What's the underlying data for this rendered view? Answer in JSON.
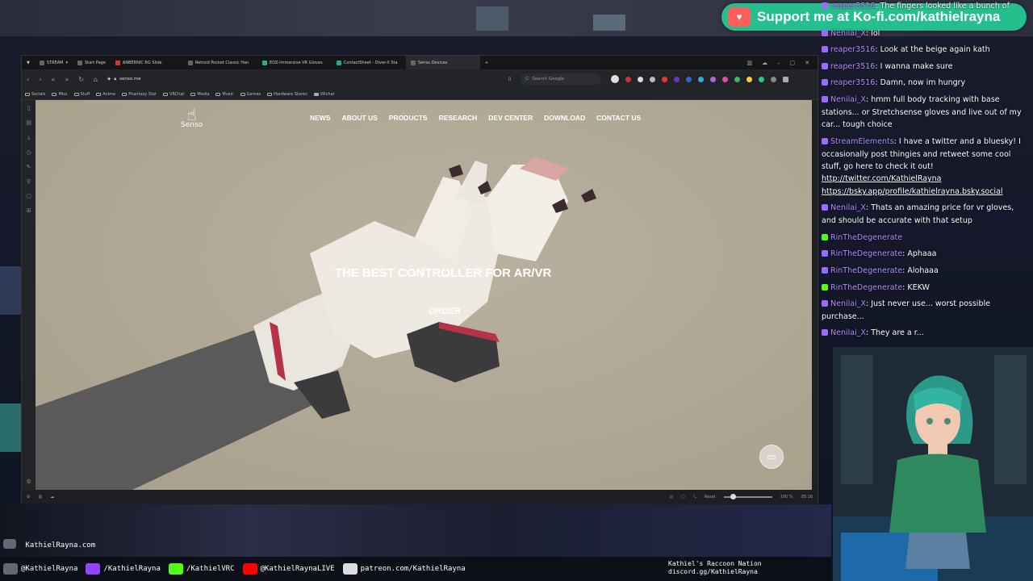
{
  "browser": {
    "tabs": [
      {
        "label": "STREAM",
        "active": false
      },
      {
        "label": "Start Page",
        "active": false
      },
      {
        "label": "ANBERNIC RG Slide",
        "active": false
      },
      {
        "label": "Retroid Pocket Classic Han",
        "active": false
      },
      {
        "label": "EOZ-Immersive VR Gloves",
        "active": false
      },
      {
        "label": "ContactSheet - Diver-X Sta",
        "active": false
      },
      {
        "label": "Senso Devices",
        "active": true
      }
    ],
    "new_tab": "+",
    "url": "senso.me",
    "search_placeholder": "Search Google",
    "bookmarks": [
      "Socials",
      "Misc",
      "Stuff",
      "Anime",
      "Phantasy Star",
      "VRChat",
      "Media",
      "Music",
      "Games",
      "Hardware Stores",
      "VRchat"
    ],
    "status": {
      "reset": "Reset",
      "zoom": "100 %",
      "clock": "05:16"
    }
  },
  "site": {
    "logo_text": "Senso",
    "nav": [
      "NEWS",
      "ABOUT US",
      "PRODUCTS",
      "RESEARCH",
      "DEV CENTER",
      "DOWNLOAD",
      "CONTACT US"
    ],
    "hero_title": "THE BEST CONTROLLER FOR AR/VR",
    "cta": "ORDER"
  },
  "overlay": {
    "kofi": "Support me at Ko-fi.com/kathielrayna",
    "chat": [
      {
        "name": "reaper3516",
        "text": "The fingers looked like a bunch of",
        "badge": "sub"
      },
      {
        "name": "",
        "text": "",
        "badge": ""
      },
      {
        "name": "Nenilai_X",
        "text": "lol",
        "badge": "sub"
      },
      {
        "name": "reaper3516",
        "text": "Look at the beige again kath",
        "badge": "sub"
      },
      {
        "name": "reaper3516",
        "text": "I wanna make sure",
        "badge": "sub"
      },
      {
        "name": "reaper3516",
        "text": "Damn, now im hungry",
        "badge": "sub"
      },
      {
        "name": "Nenilai_X",
        "text": "hmm full body tracking with base stations... or Stretchsense gloves and live out of my car... tough choice",
        "badge": "sub"
      },
      {
        "name": "StreamElements",
        "text": "I have a twitter and a bluesky! I occasionally post thingies and retweet some cool stuff, go here to check it out!",
        "badge": "sub"
      },
      {
        "name": "",
        "text": "http://twitter.com/KathielRayna",
        "badge": "link"
      },
      {
        "name": "",
        "text": "https://bsky.app/profile/kathielrayna.bsky.social",
        "badge": "link"
      },
      {
        "name": "Nenilai_X",
        "text": "Thats an amazing price for vr gloves, and should be accurate with that setup",
        "badge": "sub"
      },
      {
        "name": "RinTheDegenerate",
        "text": "",
        "badge": "k"
      },
      {
        "name": "RinTheDegenerate",
        "text": "Aphaaa",
        "badge": "sub"
      },
      {
        "name": "RinTheDegenerate",
        "text": "Alohaaa",
        "badge": "sub"
      },
      {
        "name": "RinTheDegenerate",
        "text": "KEKW",
        "badge": "k"
      },
      {
        "name": "Nenilai_X",
        "text": "Just never use... worst possible purchase...",
        "badge": "sub"
      },
      {
        "name": "Nenilai_X",
        "text": "They are a r...",
        "badge": "sub"
      }
    ],
    "site_label": "KathielRayna.com",
    "socials": [
      {
        "text": "@KathielRayna",
        "color": "#1da1f2"
      },
      {
        "text": "/KathielRayna",
        "color": "#9146ff"
      },
      {
        "text": "/KathielVRC",
        "color": "#53fc18"
      },
      {
        "text": "@KathielRaynaLIVE",
        "color": "#ff0000"
      },
      {
        "text": "patreon.com/KathielRayna",
        "color": "#ffffff"
      }
    ],
    "discord_title": "Kathiel's Raccoon Nation",
    "discord_link": "discord.gg/KathielRayna"
  }
}
